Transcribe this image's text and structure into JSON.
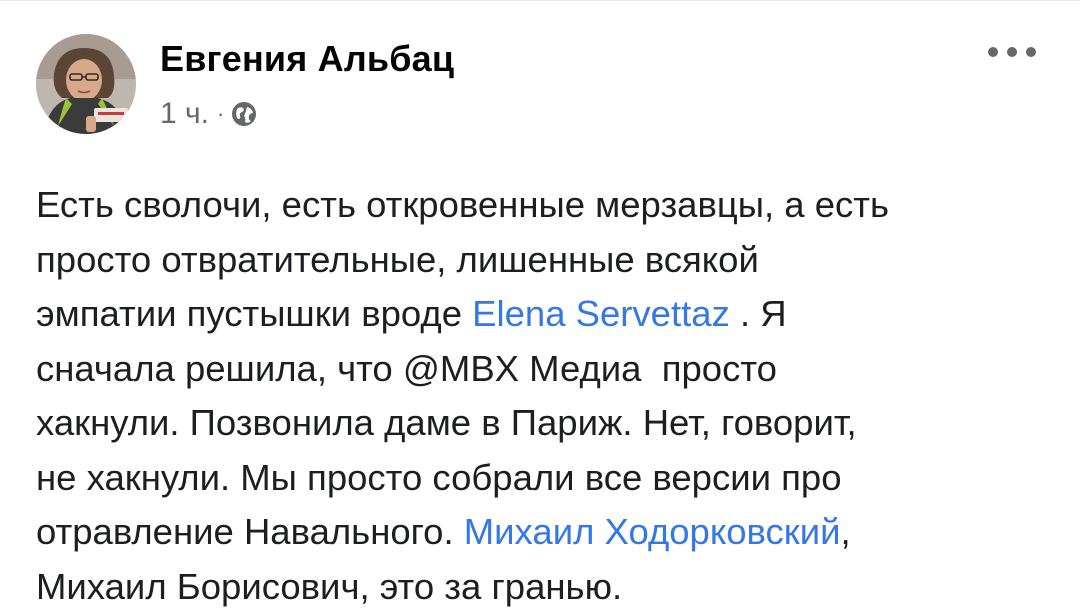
{
  "post": {
    "author": "Евгения Альбац",
    "time": "1 ч.",
    "separator": "·",
    "privacy_icon": "globe-icon",
    "more_icon": "more-horizontal-icon"
  },
  "body": {
    "line1": "Есть сволочи, есть откровенные мерзавцы, а есть",
    "line2": "просто отвратительные, лишенные всякой",
    "line3_before": "эмпатии пустышки вроде ",
    "mention1": "Elena Servettaz",
    "line3_after": " . Я",
    "line4": "сначала решила, что @MBX Медиа  просто",
    "line5": "хакнули. Позвонила даме в Париж. Нет, говорит,",
    "line6": "не хакнули. Мы просто собрали все версии про",
    "line7_before": "отравление Навального. ",
    "mention2": "Михаил Ходорковский",
    "line7_after": ",",
    "line8": "Михаил Борисович, это за гранью."
  },
  "colors": {
    "mention": "#3578e5",
    "meta": "#65676b",
    "text": "#1c1e21"
  }
}
